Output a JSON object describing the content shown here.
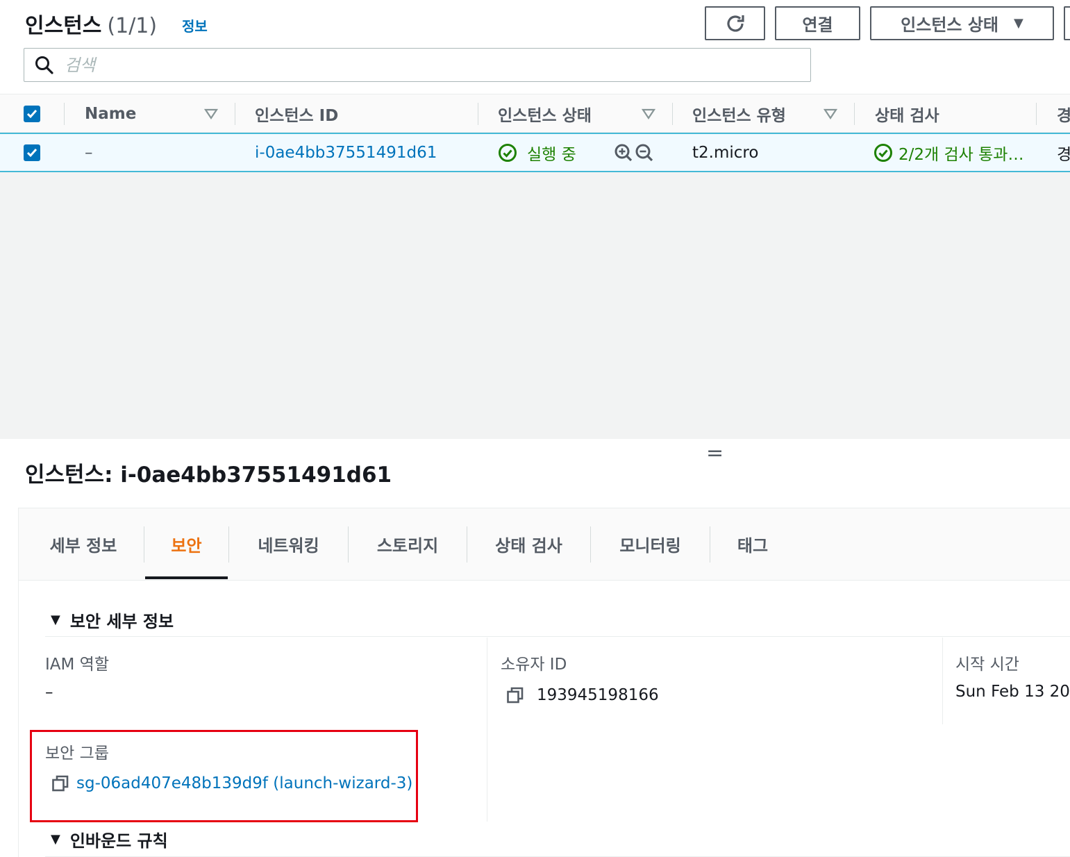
{
  "instances": {
    "title": "인스턴스",
    "count": "(1/1)",
    "info_link": "정보",
    "buttons": {
      "refresh_icon": "refresh-icon",
      "connect": "연결",
      "instance_state": "인스턴스 상태"
    },
    "search": {
      "placeholder": "검색"
    },
    "columns": [
      {
        "label": "Name",
        "sortable": true
      },
      {
        "label": "인스턴스 ID",
        "sortable": false
      },
      {
        "label": "인스턴스 상태",
        "sortable": true
      },
      {
        "label": "인스턴스 유형",
        "sortable": true
      },
      {
        "label": "상태 검사",
        "sortable": false
      },
      {
        "label": "경",
        "sortable": false
      }
    ],
    "rows": [
      {
        "selected": true,
        "name": "–",
        "instance_id": "i-0ae4bb37551491d61",
        "state": "실행 중",
        "type": "t2.micro",
        "status_check": "2/2개 검사 통과…",
        "extra": "경"
      }
    ]
  },
  "details": {
    "title": "인스턴스: i-0ae4bb37551491d61",
    "drag_handle": "=",
    "tabs": [
      {
        "label": "세부 정보",
        "active": false
      },
      {
        "label": "보안",
        "active": true
      },
      {
        "label": "네트워킹",
        "active": false
      },
      {
        "label": "스토리지",
        "active": false
      },
      {
        "label": "상태 검사",
        "active": false
      },
      {
        "label": "모니터링",
        "active": false
      },
      {
        "label": "태그",
        "active": false
      }
    ],
    "security_section": {
      "heading": "보안 세부 정보",
      "iam_role_label": "IAM 역할",
      "iam_role_value": "–",
      "owner_id_label": "소유자 ID",
      "owner_id_value": "193945198166",
      "launch_time_label": "시작 시간",
      "launch_time_value": "Sun Feb 13 202",
      "security_groups_label": "보안 그룹",
      "security_group_value": "sg-06ad407e48b139d9f (launch-wizard-3)"
    },
    "inbound_section": {
      "heading": "인바운드 규칙"
    }
  },
  "colors": {
    "link": "#0073bb",
    "success": "#1d8102",
    "active_tab": "#ec7211",
    "highlight_box": "#e60012",
    "selected_row_border": "#44b9d6"
  }
}
